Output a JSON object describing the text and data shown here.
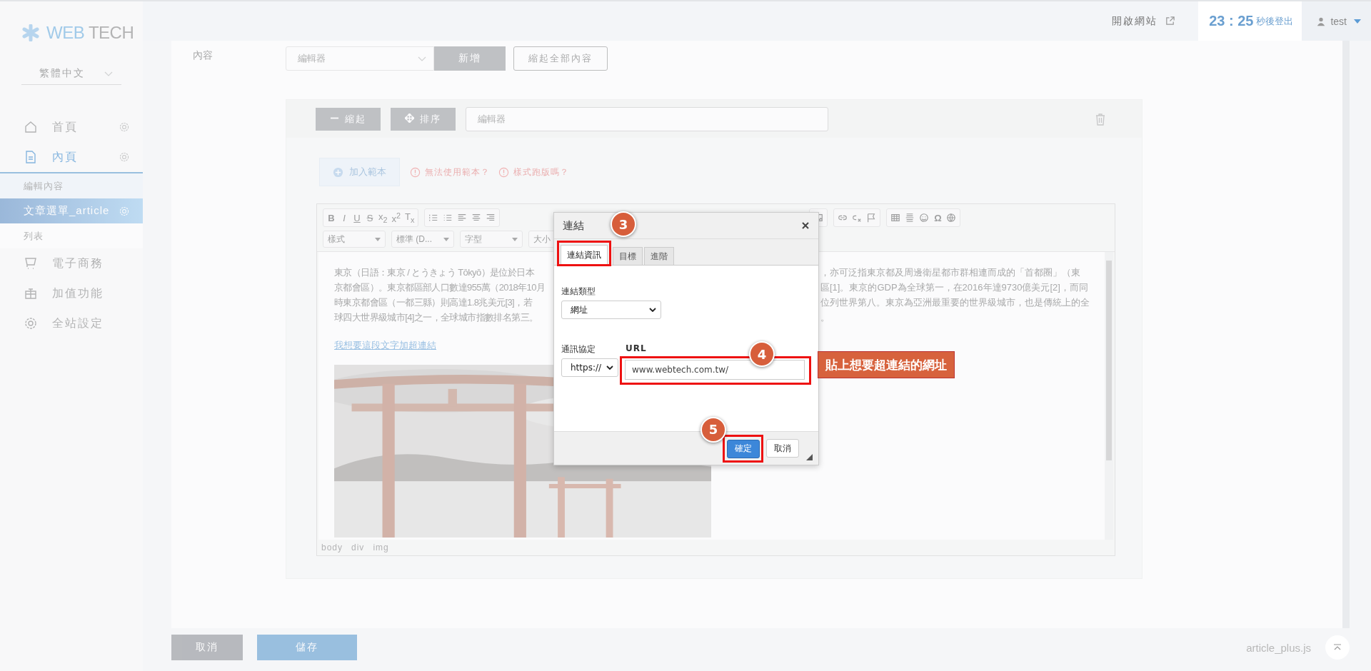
{
  "sidebar": {
    "logo": {
      "first": "WEB",
      "second": "TECH"
    },
    "language": "繁體中文",
    "items": [
      {
        "label": "首頁",
        "expanded": false,
        "has_settings": true
      },
      {
        "label": "內頁",
        "expanded": true,
        "has_settings": true,
        "children": [
          {
            "label": "編輯內容",
            "selected": false,
            "has_settings": false
          },
          {
            "label": "文章選單_article",
            "selected": true,
            "has_settings": true
          },
          {
            "label": "列表",
            "selected": false,
            "has_settings": false
          }
        ]
      },
      {
        "label": "電子商務",
        "expanded": false,
        "has_settings": false
      },
      {
        "label": "加值功能",
        "expanded": false,
        "has_settings": false
      },
      {
        "label": "全站設定",
        "expanded": false,
        "has_settings": false
      }
    ]
  },
  "topbar": {
    "open_site": "開啟網站",
    "time": "23 : 25",
    "time_suffix": "秒後登出",
    "user": "test"
  },
  "content": {
    "field_label": "內容",
    "type_select": "編輯器",
    "add_button": "新增",
    "collapse_all_button": "縮起全部內容",
    "block": {
      "collapse_button": "縮起",
      "sort_button": "排序",
      "name_value": "編輯器",
      "template_button": "加入範本",
      "help_links": [
        "無法使用範本？",
        "樣式跑版嗎？"
      ],
      "editor": {
        "format_glyphs": [
          "B",
          "I",
          "U",
          "S",
          "x$_{2}$",
          "x$^{2}$",
          "T$_{x}$"
        ],
        "symbol_glyph": "Ω",
        "dropdowns": [
          "樣式",
          "標準 (D...",
          "字型",
          "大小"
        ],
        "lines": [
          {
            "left": "東京（日語：東京 / とうきょう Tōkyō）是位於日本",
            "right": "，亦可泛指東京都及周邊衛星都市群相連而成的「首都圈」（東"
          },
          {
            "left": "京都會區）。東京都區部人口數達955萬（2018年10月",
            "right": "區[1]。東京的GDP為全球第一，在2016年達9730億美元[2]，而同"
          },
          {
            "left": "時東京都會區（一都三縣）則高達1.8兆美元[3]，若",
            "right": "位列世界第八。東京為亞洲最重要的世界級城市，也是傳統上的全"
          },
          {
            "left": "球四大世界級城市[4]之一，全球城市指數排名第三。",
            "right": "。"
          }
        ],
        "link": "我想要這段文字加超連結",
        "image": {
          "kind": "picture"
        },
        "path": [
          "body",
          "div",
          "img"
        ]
      }
    }
  },
  "dialog": {
    "title": "連結",
    "tabs": [
      {
        "label": "連結資訊",
        "selected": true,
        "step": "3"
      },
      {
        "label": "目標",
        "selected": false
      },
      {
        "label": "進階",
        "selected": false
      }
    ],
    "link_type_label": "連結類型",
    "link_type": "網址",
    "protocol_label": "通訊協定",
    "protocol": "https://",
    "url_label": "URL",
    "url": {
      "value": "www.webtech.com.tw/",
      "step": "4"
    },
    "ok_button": {
      "label": "確定",
      "step": "5"
    },
    "cancel_button": "取消",
    "callout": "貼上想要超連結的網址"
  },
  "footer": {
    "cancel_button": "取消",
    "save_button": "儲存",
    "file_name": "article_plus.js"
  }
}
